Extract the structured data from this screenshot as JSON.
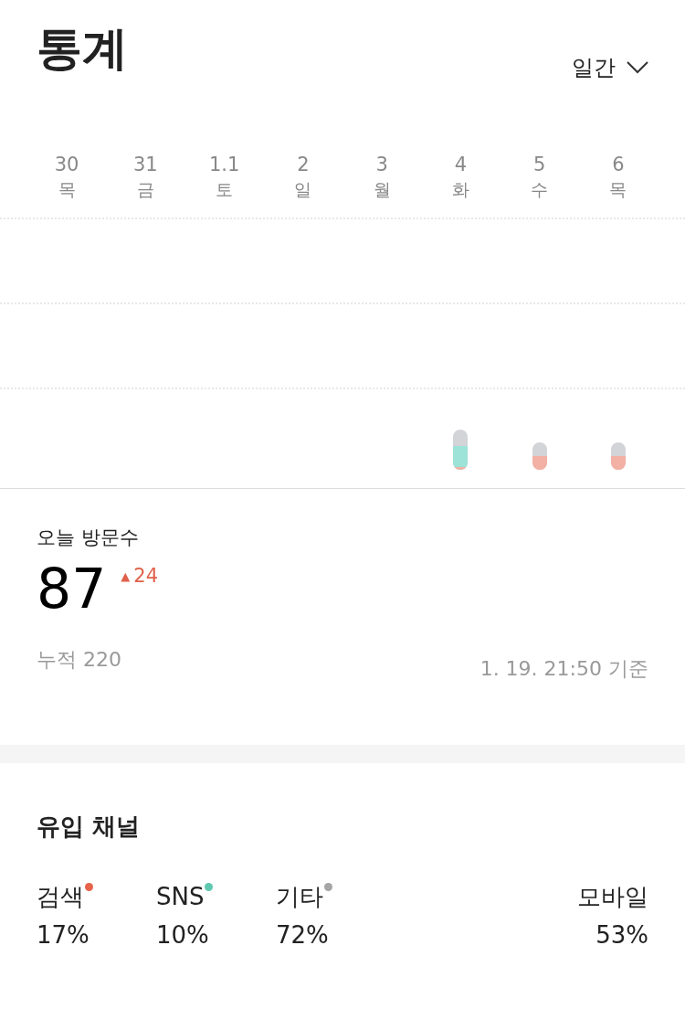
{
  "title": "통계",
  "period": {
    "label": "일간"
  },
  "days": [
    {
      "date": "30",
      "weekday": "목"
    },
    {
      "date": "31",
      "weekday": "금"
    },
    {
      "date": "1.1",
      "weekday": "토"
    },
    {
      "date": "2",
      "weekday": "일"
    },
    {
      "date": "3",
      "weekday": "월"
    },
    {
      "date": "4",
      "weekday": "화",
      "bar": {
        "level": 0.6,
        "color": "#9de3d8"
      }
    },
    {
      "date": "5",
      "weekday": "수",
      "bar": {
        "level": 0.5,
        "color": "#f3b0a4"
      }
    },
    {
      "date": "6",
      "weekday": "목",
      "bar": {
        "level": 0.5,
        "color": "#f3b0a4"
      }
    }
  ],
  "today": {
    "label": "오늘 방문수",
    "value": "87",
    "change_icon": "▲",
    "change": "24",
    "total": "누적 220",
    "timestamp": "1. 19. 21:50 기준"
  },
  "channels": {
    "title": "유입 채널",
    "items": [
      {
        "label": "검색",
        "percent": "17%",
        "color": "#e8634a"
      },
      {
        "label": "SNS",
        "percent": "10%",
        "color": "#5fc8b0"
      },
      {
        "label": "기타",
        "percent": "72%",
        "color": "#a5a5a8"
      }
    ],
    "mobile": {
      "label": "모바일",
      "percent": "53%"
    }
  }
}
